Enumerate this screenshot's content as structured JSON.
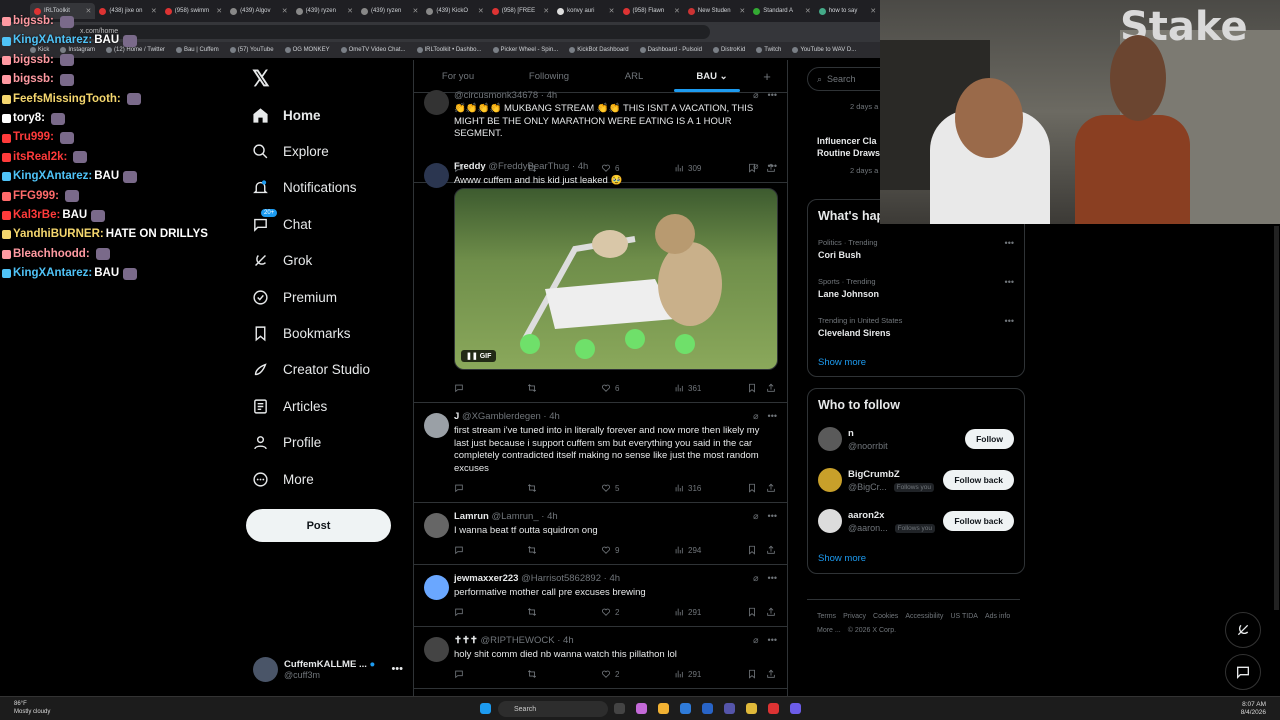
{
  "browser": {
    "tabs": [
      "IRLToolkit",
      "(438) jixe on",
      "(958) swimm",
      "(439) Algov",
      "(439) ryzen",
      "(439) ryzen",
      "(439) KickO",
      "(958) [FREE",
      "konvy auri",
      "(958) Flawn",
      "New Studen",
      "Standard A",
      "how to say"
    ],
    "url": "x.com/home",
    "bookmarks": [
      "Kick",
      "Instagram",
      "(12) Home / Twitter",
      "Bau | Cuffem",
      "(57) YouTube",
      "OG MONKEY",
      "OmeTV Video Chat...",
      "IRLToolkit • Dashbo...",
      "Picker Wheel - Spin...",
      "KickBot Dashboard",
      "Dashboard - Pulsoid",
      "DistroKid",
      "Twitch",
      "YouTube to WAV D..."
    ]
  },
  "chat": [
    {
      "user": "bigssb:",
      "color": "#ff9aa2",
      "msg": ""
    },
    {
      "user": "KingXAntarez:",
      "color": "#4fc3f7",
      "msg": "BAU"
    },
    {
      "user": "bigssb:",
      "color": "#ff9aa2",
      "msg": ""
    },
    {
      "user": "bigssb:",
      "color": "#ff9aa2",
      "msg": ""
    },
    {
      "user": "FeefsMissingTooth:",
      "color": "#f5d76e",
      "msg": ""
    },
    {
      "user": "tory8:",
      "color": "#ffffff",
      "msg": ""
    },
    {
      "user": "Tru999:",
      "color": "#ff3b3b",
      "msg": ""
    },
    {
      "user": "itsReal2k:",
      "color": "#ff3b3b",
      "msg": ""
    },
    {
      "user": "KingXAntarez:",
      "color": "#4fc3f7",
      "msg": "BAU"
    },
    {
      "user": "FFG999:",
      "color": "#ff6b6b",
      "msg": ""
    },
    {
      "user": "Kal3rBe:",
      "color": "#ff3b3b",
      "msg": "BAU"
    },
    {
      "user": "YandhiBURNER:",
      "color": "#f5d76e",
      "msg": "HATE ON DRILLYS"
    },
    {
      "user": "Bleachhoodd:",
      "color": "#ff9aa2",
      "msg": ""
    },
    {
      "user": "KingXAntarez:",
      "color": "#4fc3f7",
      "msg": "BAU"
    }
  ],
  "nav": {
    "items": [
      "Home",
      "Explore",
      "Notifications",
      "Chat",
      "Grok",
      "Premium",
      "Bookmarks",
      "Creator Studio",
      "Articles",
      "Profile",
      "More"
    ],
    "chat_badge": "20+",
    "post_label": "Post"
  },
  "account": {
    "name": "CuffemKALLME ...",
    "handle": "@cuff3m"
  },
  "timeline": {
    "tabs": [
      "For you",
      "Following",
      "ARL",
      "BAU"
    ],
    "tweets": [
      {
        "name": "",
        "handle": "@circusmonk34678",
        "time": "4h",
        "text": "👏👏👏👏 MUKBANG STREAM 👏👏 THIS ISNT A VACATION, THIS MIGHT BE THE ONLY MARATHON WERE EATING IS A 1 HOUR SEGMENT.",
        "likes": "6",
        "views": "309"
      },
      {
        "name": "Freddy",
        "handle": "@FreddyBearThug",
        "time": "4h",
        "text": "Awww cuffem and his kid just leaked 🥹",
        "likes": "6",
        "views": "361",
        "media_label": "GIF"
      },
      {
        "name": "J",
        "handle": "@XGamblerdegen",
        "time": "4h",
        "text": "first stream i've tuned into in literally forever and now more then likely my last just because i support cuffem sm but everything you said in the car completely contradicted itself making no sense like just the most random excuses",
        "likes": "5",
        "views": "316"
      },
      {
        "name": "Lamrun",
        "handle": "@Lamrun_",
        "time": "4h",
        "text": "I wanna beat tf outta squidron ong",
        "likes": "9",
        "views": "294"
      },
      {
        "name": "jewmaxxer223",
        "handle": "@Harrisot5862892",
        "time": "4h",
        "text": "performative mother call pre excuses brewing",
        "likes": "2",
        "views": "291"
      },
      {
        "name": "✝✝✝",
        "handle": "@RIPTHEWOCK",
        "time": "4h",
        "text": "holy shit comm died nb wanna watch this pillathon lol",
        "likes": "2",
        "views": "291"
      }
    ]
  },
  "sidebar": {
    "search_placeholder": "Search",
    "peek_meta1": "2 days a",
    "peek_title": "Influencer Cla",
    "peek_title2": "Routine Draws",
    "peek_meta2": "2 days a",
    "trending_title": "What's hap",
    "trends": [
      {
        "context": "Politics · Trending",
        "name": "Cori Bush"
      },
      {
        "context": "Sports · Trending",
        "name": "Lane Johnson"
      },
      {
        "context": "Trending in United States",
        "name": "Cleveland Sirens"
      }
    ],
    "show_more": "Show more",
    "wtf_title": "Who to follow",
    "wtf": [
      {
        "name": "n",
        "handle": "@noorrbit",
        "follows_you": "",
        "button": "Follow"
      },
      {
        "name": "BigCrumbZ",
        "handle": "@BigCr...",
        "follows_you": "Follows you",
        "button": "Follow back"
      },
      {
        "name": "aaron2x",
        "handle": "@aaron...",
        "follows_you": "Follows you",
        "button": "Follow back"
      }
    ],
    "footer": [
      "Terms",
      "Privacy",
      "Cookies",
      "Accessibility",
      "US TIDA",
      "Ads info",
      "More ...",
      "© 2026 X Corp."
    ]
  },
  "webcam": {
    "logo": "Stake"
  },
  "taskbar": {
    "weather_temp": "86°F",
    "weather_desc": "Mostly cloudy",
    "search": "Search",
    "time": "8:07 AM",
    "date": "8/4/2026"
  },
  "colors": {
    "accent": "#1d9bf0",
    "bg": "#000000",
    "border": "#2f3336",
    "muted": "#71767b"
  }
}
